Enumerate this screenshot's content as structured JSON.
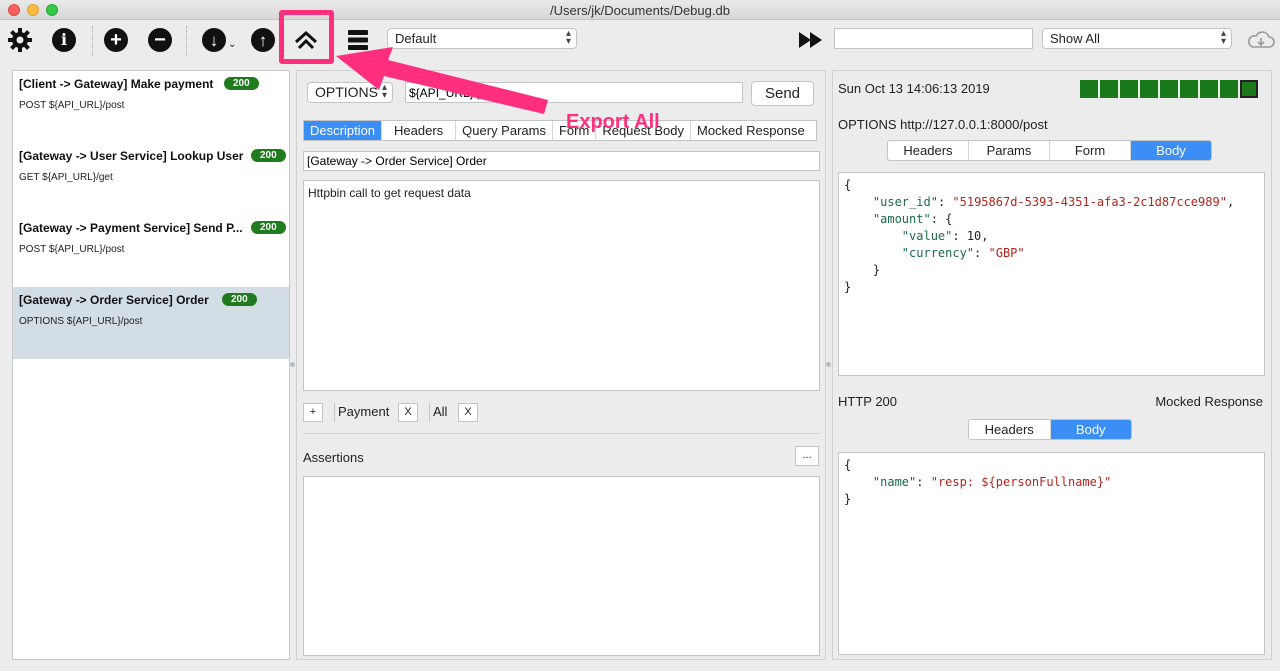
{
  "window": {
    "title": "/Users/jk/Documents/Debug.db"
  },
  "toolbar": {
    "environment_select": "Default",
    "filter_select": "Show All",
    "search_value": "",
    "search_placeholder": ""
  },
  "requests": [
    {
      "title": "[Client -> Gateway] Make payment",
      "status": "200",
      "summary": "POST ${API_URL}/post",
      "selected": false
    },
    {
      "title": "[Gateway -> User Service] Lookup User",
      "status": "200",
      "summary": "GET ${API_URL}/get",
      "selected": false
    },
    {
      "title": "[Gateway -> Payment Service] Send P...",
      "status": "200",
      "summary": "POST ${API_URL}/post",
      "selected": false
    },
    {
      "title": "[Gateway -> Order Service] Order",
      "status": "200",
      "summary": "OPTIONS ${API_URL}/post",
      "selected": true
    }
  ],
  "editor": {
    "method": "OPTIONS",
    "url": "${API_URL}/post",
    "send_label": "Send",
    "tabs": [
      "Description",
      "Headers",
      "Query Params",
      "Form",
      "Request Body",
      "Mocked Response"
    ],
    "active_tab": "Description",
    "name": "[Gateway -> Order Service] Order",
    "description": "Httpbin call to get request data",
    "add_tag_label": "+",
    "tags": [
      "Payment",
      "All"
    ],
    "tag_remove_label": "X",
    "assertions_label": "Assertions",
    "assertions_more_label": "..."
  },
  "response": {
    "timestamp": "Sun Oct 13 14:06:13 2019",
    "request_line": "OPTIONS http://127.0.0.1:8000/post",
    "request_tabs": [
      "Headers",
      "Params",
      "Form",
      "Body"
    ],
    "request_active_tab": "Body",
    "status_line": "HTTP 200",
    "mocked_label": "Mocked Response",
    "response_tabs": [
      "Headers",
      "Body"
    ],
    "response_active_tab": "Body",
    "status_history_count": 9,
    "status_color": "#1a7a1a"
  },
  "request_body": {
    "user_id_key": "\"user_id\"",
    "user_id_val": "\"5195867d-5393-4351-afa3-2c1d87cce989\"",
    "amount_key": "\"amount\"",
    "value_key": "\"value\"",
    "value_val": "10",
    "currency_key": "\"currency\"",
    "currency_val": "\"GBP\""
  },
  "response_body": {
    "name_key": "\"name\"",
    "name_val": "\"resp: ${personFullname}\""
  },
  "annotation": {
    "label": "Export All",
    "color": "#ff2f7d"
  }
}
